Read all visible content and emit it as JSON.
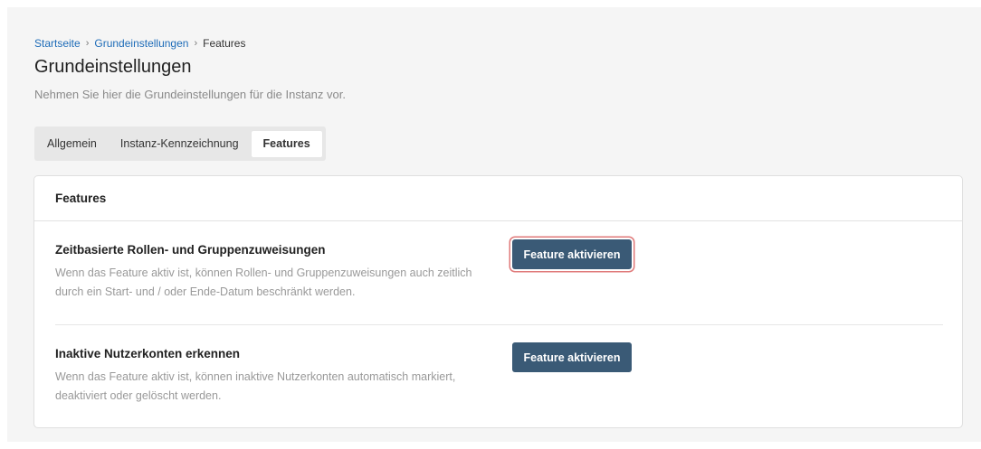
{
  "breadcrumb": {
    "items": [
      "Startseite",
      "Grundeinstellungen",
      "Features"
    ],
    "separator": "›"
  },
  "header": {
    "title": "Grundeinstellungen",
    "subtitle": "Nehmen Sie hier die Grundeinstellungen für die Instanz vor."
  },
  "tabs": [
    {
      "label": "Allgemein",
      "active": false
    },
    {
      "label": "Instanz-Kennzeichnung",
      "active": false
    },
    {
      "label": "Features",
      "active": true
    }
  ],
  "card": {
    "title": "Features",
    "features": [
      {
        "title": "Zeitbasierte Rollen- und Gruppenzuweisungen",
        "description": "Wenn das Feature aktiv ist, können Rollen- und Gruppenzuweisungen auch zeitlich durch ein Start- und / oder Ende-Datum beschränkt werden.",
        "button_label": "Feature aktivieren",
        "focused": true
      },
      {
        "title": "Inaktive Nutzerkonten erkennen",
        "description": "Wenn das Feature aktiv ist, können inaktive Nutzerkonten automatisch markiert, deaktiviert oder gelöscht werden.",
        "button_label": "Feature aktivieren",
        "focused": false
      }
    ]
  },
  "colors": {
    "link": "#1e6cb8",
    "button_bg": "#3a5a76",
    "focus_ring": "#e07a7a",
    "page_bg": "#f5f5f5"
  }
}
